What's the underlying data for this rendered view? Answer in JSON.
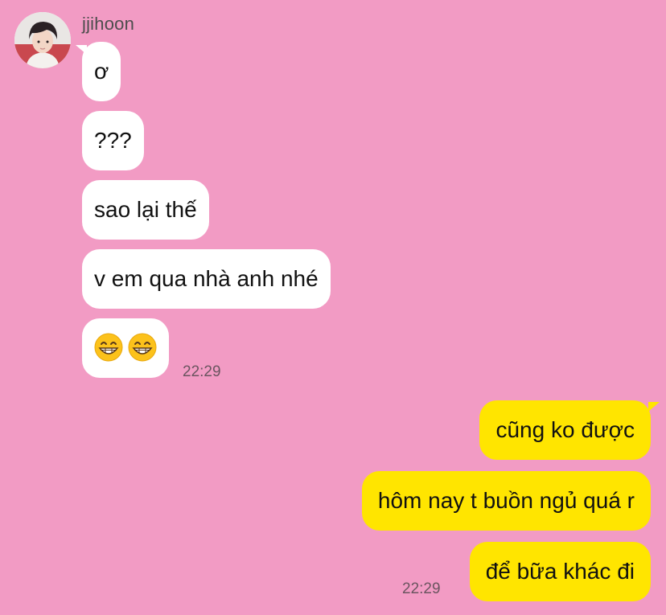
{
  "contact": {
    "name": "jjihoon",
    "avatar_icon": "profile-photo"
  },
  "incoming": {
    "messages": [
      {
        "text": "ơ"
      },
      {
        "text": "???"
      },
      {
        "text": "sao lại thế"
      },
      {
        "text": "v em qua nhà anh nhé"
      },
      {
        "emoji": [
          "grinning-face-with-smiling-eyes",
          "grinning-face-with-smiling-eyes"
        ]
      }
    ],
    "time": "22:29"
  },
  "outgoing": {
    "messages": [
      {
        "text": "cũng ko được"
      },
      {
        "text": "hôm nay t buồn ngủ quá r"
      },
      {
        "text": "để bữa khác đi"
      }
    ],
    "time": "22:29"
  },
  "colors": {
    "background": "#f29bc4",
    "incoming_bubble": "#ffffff",
    "outgoing_bubble": "#ffe500"
  }
}
